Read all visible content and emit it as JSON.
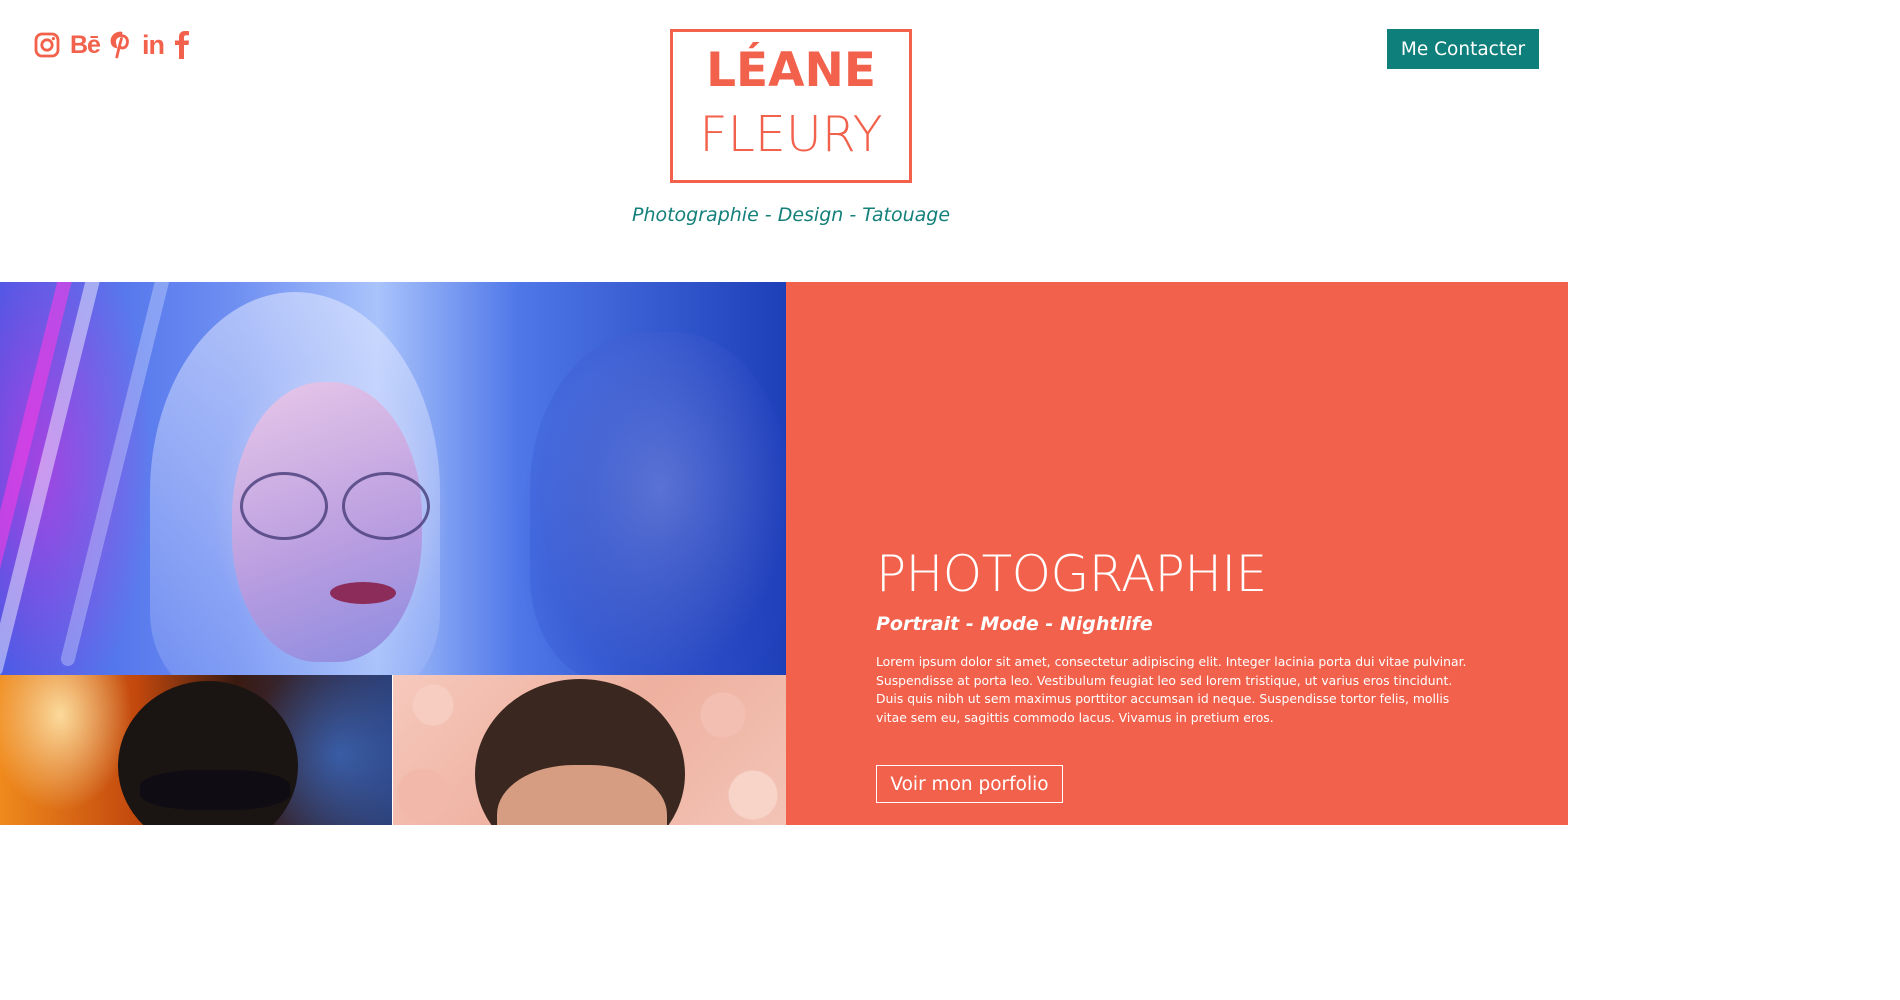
{
  "header": {
    "social": [
      {
        "name": "instagram-icon"
      },
      {
        "name": "behance-icon",
        "glyph": "Bē"
      },
      {
        "name": "pinterest-icon"
      },
      {
        "name": "linkedin-icon",
        "glyph": "in"
      },
      {
        "name": "facebook-icon"
      }
    ],
    "logo": {
      "first": "LÉANE",
      "last": "FLEURY"
    },
    "tagline": "Photographie - Design - Tatouage",
    "contact_label": "Me Contacter"
  },
  "section": {
    "title": "PHOTOGRAPHIE",
    "subtitle": "Portrait - Mode - Nightlife",
    "text": "Lorem ipsum dolor sit amet, consectetur adipiscing elit. Integer lacinia porta dui vitae pulvinar. Suspendisse at porta leo. Vestibulum feugiat leo sed lorem tristique, ut varius eros tincidunt. Duis quis nibh ut sem maximus porttitor accumsan id neque. Suspendisse tortor felis, mollis vitae sem eu, sagittis commodo lacus. Vivamus in pretium eros.",
    "button_label": "Voir mon porfolio"
  },
  "colors": {
    "accent": "#f2614c",
    "teal": "#0e7f7a",
    "white": "#ffffff"
  }
}
